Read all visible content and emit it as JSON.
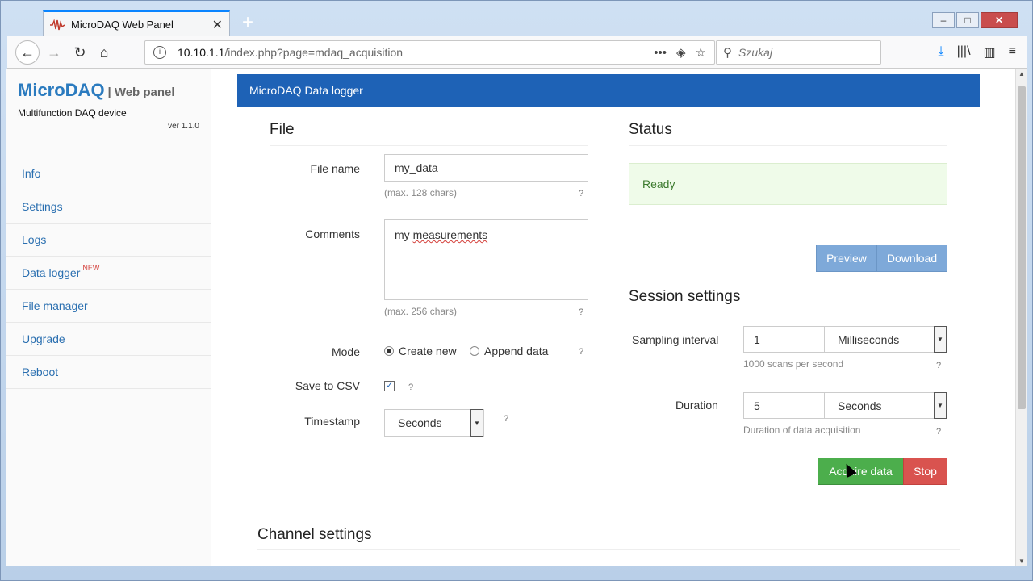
{
  "browser": {
    "tab_title": "MicroDAQ Web Panel",
    "url_host": "10.10.1.1",
    "url_path": "/index.php?page=mdaq_acquisition",
    "search_placeholder": "Szukaj"
  },
  "sidebar": {
    "brand": "MicroDAQ",
    "brand_suffix": "| Web panel",
    "tagline": "Multifunction DAQ device",
    "version": "ver 1.1.0",
    "items": [
      {
        "label": "Info"
      },
      {
        "label": "Settings"
      },
      {
        "label": "Logs"
      },
      {
        "label": "Data logger",
        "badge": "NEW"
      },
      {
        "label": "File manager"
      },
      {
        "label": "Upgrade"
      },
      {
        "label": "Reboot"
      }
    ]
  },
  "header": {
    "title": "MicroDAQ Data logger"
  },
  "file": {
    "title": "File",
    "file_name_label": "File name",
    "file_name_value": "my_data",
    "file_name_hint": "(max. 128 chars)",
    "comments_label": "Comments",
    "comments_word1": "my",
    "comments_word2": "measurements",
    "comments_hint": "(max. 256 chars)",
    "mode_label": "Mode",
    "mode_create": "Create new",
    "mode_append": "Append data",
    "mode_selected": "Create new",
    "csv_label": "Save to CSV",
    "csv_checked": true,
    "timestamp_label": "Timestamp",
    "timestamp_value": "Seconds",
    "help": "?"
  },
  "status": {
    "title": "Status",
    "message": "Ready",
    "preview_label": "Preview",
    "download_label": "Download"
  },
  "session": {
    "title": "Session settings",
    "sampling_label": "Sampling interval",
    "sampling_value": "1",
    "sampling_unit": "Milliseconds",
    "sampling_hint": "1000 scans per second",
    "duration_label": "Duration",
    "duration_value": "5",
    "duration_unit": "Seconds",
    "duration_hint": "Duration of data acquisition",
    "acquire_label": "Acquire data",
    "stop_label": "Stop"
  },
  "channel": {
    "title": "Channel settings"
  },
  "colors": {
    "header_blue": "#1e62b6",
    "success": "#4cae4c",
    "danger": "#d9534f",
    "status_bg": "#effbe9"
  }
}
